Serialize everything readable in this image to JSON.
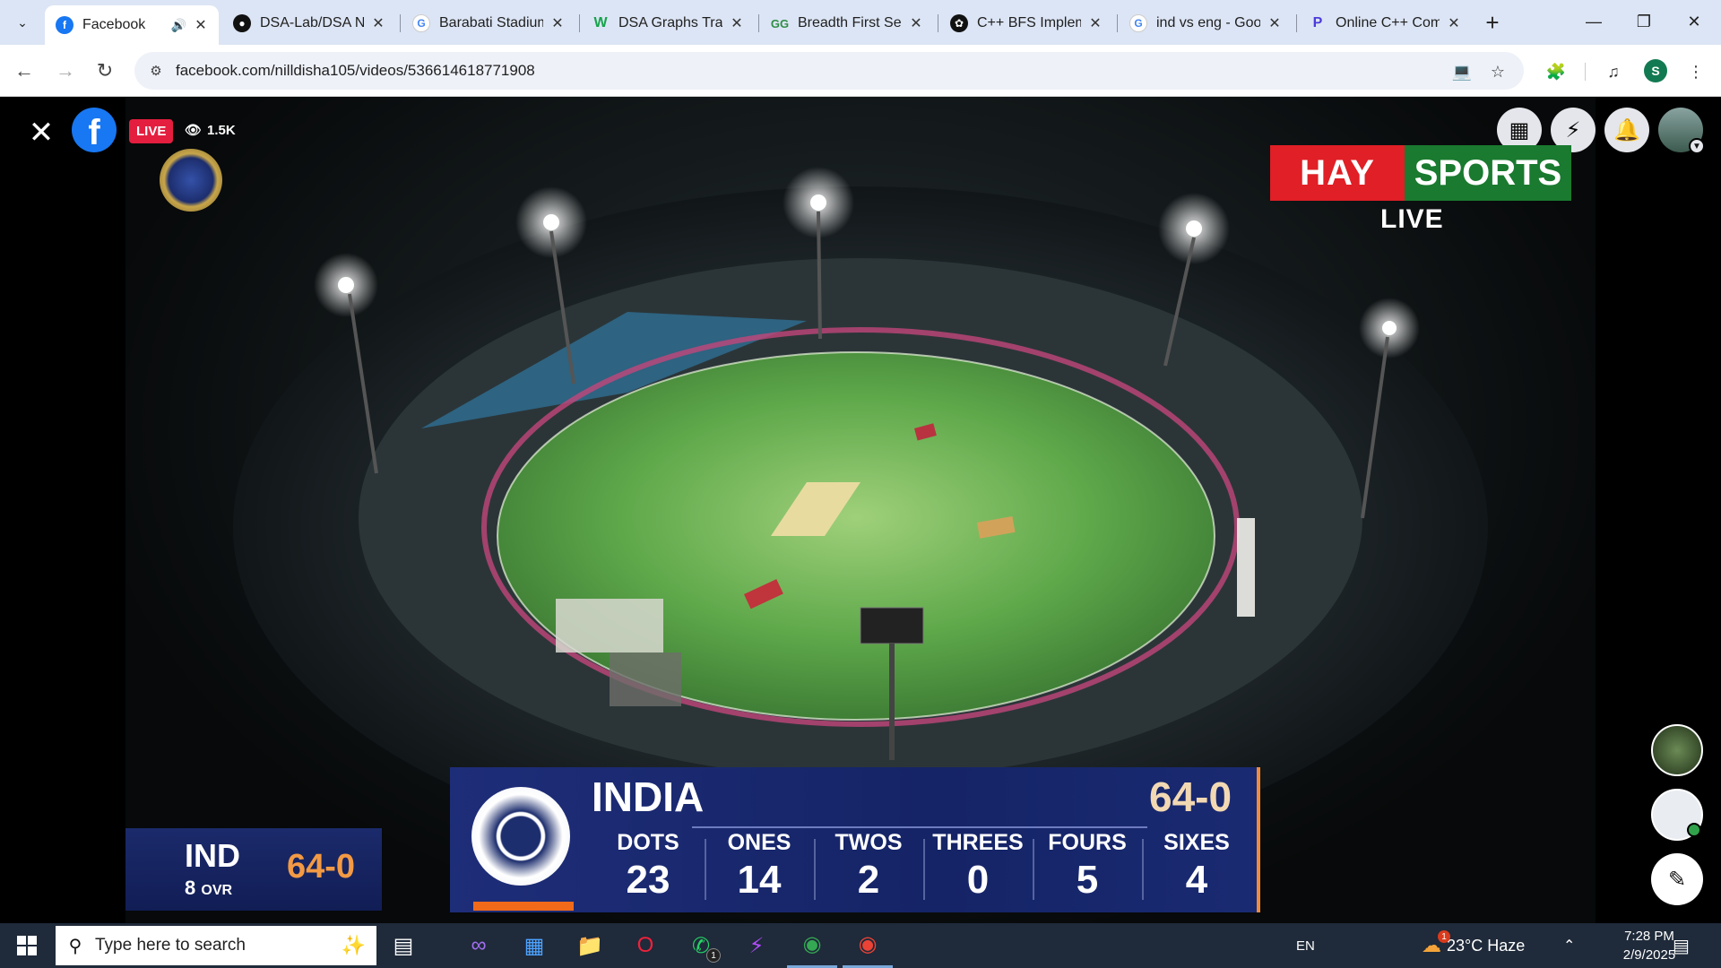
{
  "browser": {
    "tabs": [
      {
        "label": "Facebook",
        "icon": "facebook-icon",
        "active": true,
        "audio": true
      },
      {
        "label": "DSA-Lab/DSA Notes",
        "icon": "github-icon"
      },
      {
        "label": "Barabati Stadium",
        "icon": "google-icon"
      },
      {
        "label": "DSA Graphs Traversal",
        "icon": "w-icon"
      },
      {
        "label": "Breadth First Search",
        "icon": "gfg-icon"
      },
      {
        "label": "C++ BFS Implementation",
        "icon": "chatgpt-icon"
      },
      {
        "label": "ind vs eng - Google Search",
        "icon": "google-icon"
      },
      {
        "label": "Online C++ Compiler",
        "icon": "programiz-icon"
      }
    ],
    "url": "facebook.com/nilldisha105/videos/536614618771908",
    "profile_initial": "S"
  },
  "video": {
    "live_label": "LIVE",
    "viewer_count": "1.5K",
    "broadcaster_logo": {
      "part1": "HAY",
      "part2": "SPORTS",
      "sub": "LIVE"
    }
  },
  "scoreboard": {
    "small": {
      "team": "IND",
      "overs": "8",
      "overs_unit": "OVR",
      "score": "64-0"
    },
    "main": {
      "team": "INDIA",
      "score": "64-0",
      "stats": [
        {
          "label": "DOTS",
          "value": "23"
        },
        {
          "label": "ONES",
          "value": "14"
        },
        {
          "label": "TWOS",
          "value": "2"
        },
        {
          "label": "THREES",
          "value": "0"
        },
        {
          "label": "FOURS",
          "value": "5"
        },
        {
          "label": "SIXES",
          "value": "4"
        }
      ]
    }
  },
  "taskbar": {
    "search_placeholder": "Type here to search",
    "language": "EN",
    "weather": "23°C  Haze",
    "weather_badge": "1",
    "whatsapp_badge": "1",
    "time": "7:28 PM",
    "date": "2/9/2025"
  },
  "colors": {
    "tabstrip": "#dce5f5",
    "facebook_blue": "#1877f2",
    "live_red": "#e41e3f",
    "score_orange": "#f39a44",
    "scoreboard_navy": "#1b2a6b",
    "hay_red": "#e01f26",
    "sports_green": "#1a7a2f"
  }
}
